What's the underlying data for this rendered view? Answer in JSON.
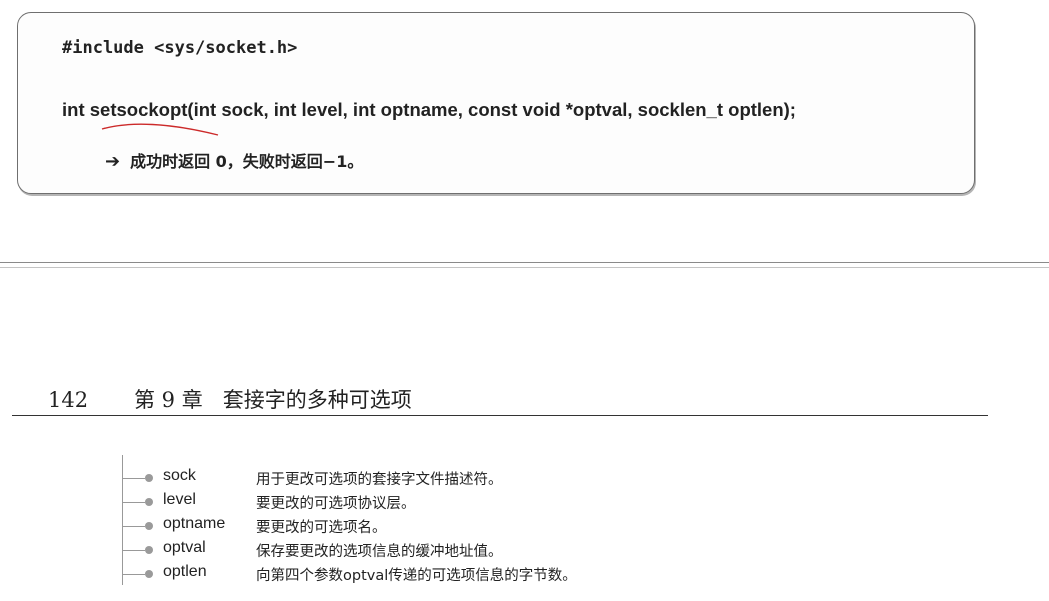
{
  "code_box": {
    "include_line": "#include <sys/socket.h>",
    "signature_kw": "int",
    "signature_name": "setsockopt",
    "signature_args": "(int sock, int level, int optname, const void *optval, socklen_t optlen);",
    "return_arrow": "➔",
    "return_text": "成功时返回 0，失败时返回−1。"
  },
  "page_header": {
    "page_number": "142",
    "chapter": "第 9 章",
    "title": "套接字的多种可选项"
  },
  "params": [
    {
      "name": "sock",
      "desc": "用于更改可选项的套接字文件描述符。"
    },
    {
      "name": "level",
      "desc": "要更改的可选项协议层。"
    },
    {
      "name": "optname",
      "desc": "要更改的可选项名。"
    },
    {
      "name": "optval",
      "desc": "保存要更改的选项信息的缓冲地址值。"
    },
    {
      "name": "optlen",
      "desc": "向第四个参数optval传递的可选项信息的字节数。"
    }
  ],
  "colors": {
    "underline_annotation": "#cc2a2a",
    "text": "#222222"
  }
}
